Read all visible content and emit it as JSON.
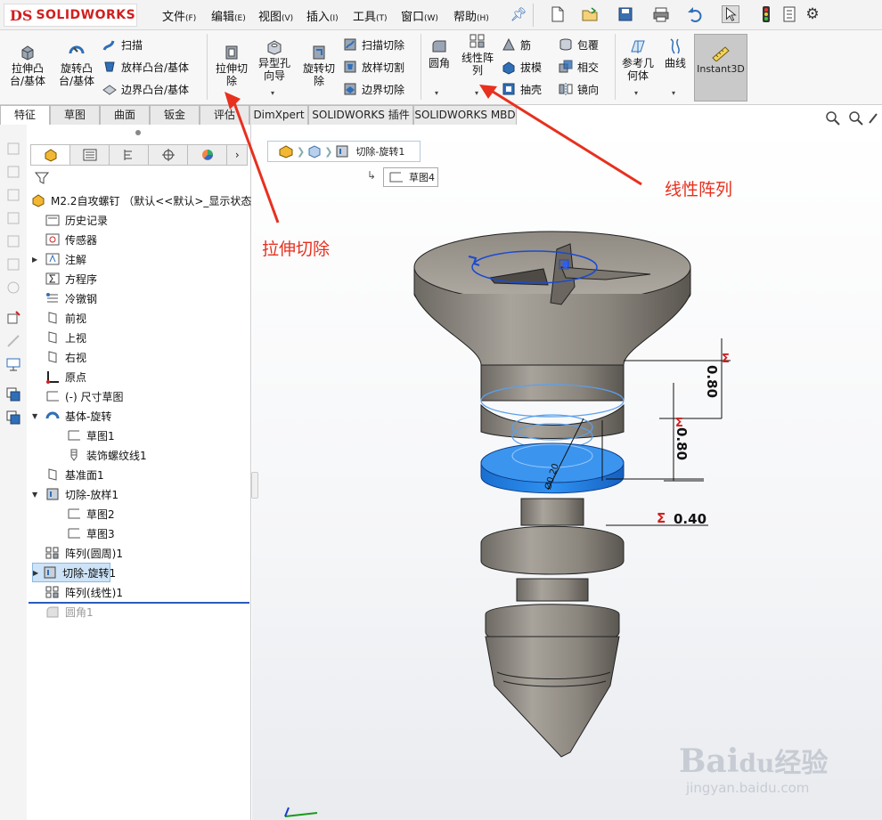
{
  "app": {
    "logo_prefix": "DS",
    "logo_text": "SOLIDWORKS"
  },
  "menu": [
    {
      "label": "文件",
      "key": "(F)"
    },
    {
      "label": "编辑",
      "key": "(E)"
    },
    {
      "label": "视图",
      "key": "(V)"
    },
    {
      "label": "插入",
      "key": "(I)"
    },
    {
      "label": "工具",
      "key": "(T)"
    },
    {
      "label": "窗口",
      "key": "(W)"
    },
    {
      "label": "帮助",
      "key": "(H)"
    }
  ],
  "ribbon": {
    "extrude_boss_l1": "拉伸凸",
    "extrude_boss_l2": "台/基体",
    "revolve_boss_l1": "旋转凸",
    "revolve_boss_l2": "台/基体",
    "sweep": "扫描",
    "loft_boss": "放样凸台/基体",
    "boundary_boss": "边界凸台/基体",
    "extrude_cut_l1": "拉伸切",
    "extrude_cut_l2": "除",
    "hole_wizard_l1": "异型孔",
    "hole_wizard_l2": "向导",
    "revolve_cut_l1": "旋转切",
    "revolve_cut_l2": "除",
    "swept_cut": "扫描切除",
    "lofted_cut": "放样切割",
    "boundary_cut": "边界切除",
    "fillet": "圆角",
    "linear_pattern_l1": "线性阵",
    "linear_pattern_l2": "列",
    "rib": "筋",
    "draft": "拔模",
    "shell": "抽壳",
    "wrap": "包覆",
    "intersect": "相交",
    "mirror": "镜向",
    "ref_geom_l1": "参考几",
    "ref_geom_l2": "何体",
    "curves": "曲线",
    "instant3d": "Instant3D"
  },
  "tabs": [
    "特征",
    "草图",
    "曲面",
    "钣金",
    "评估",
    "DimXpert",
    "SOLIDWORKS 插件",
    "SOLIDWORKS MBD"
  ],
  "tree": {
    "root": "M2.2自攻螺钉 （默认<<默认>_显示状态",
    "items": [
      {
        "label": "历史记录"
      },
      {
        "label": "传感器"
      },
      {
        "label": "注解"
      },
      {
        "label": "方程序"
      },
      {
        "label": "冷镦钢"
      },
      {
        "label": "前视"
      },
      {
        "label": "上视"
      },
      {
        "label": "右视"
      },
      {
        "label": "原点"
      },
      {
        "label": "(-) 尺寸草图"
      },
      {
        "label": "基体-旋转"
      },
      {
        "label": "草图1"
      },
      {
        "label": "装饰螺纹线1"
      },
      {
        "label": "基准面1"
      },
      {
        "label": "切除-放样1"
      },
      {
        "label": "草图2"
      },
      {
        "label": "草图3"
      },
      {
        "label": "阵列(圆周)1"
      },
      {
        "label": "切除-旋转1"
      },
      {
        "label": "阵列(线性)1"
      },
      {
        "label": "圆角1"
      }
    ]
  },
  "viewport": {
    "breadcrumb": "切除-旋转1",
    "sketch_chip": "草图4",
    "dims": [
      "0.80",
      "0.80",
      "0.40"
    ],
    "diam_label": "Ø0.20"
  },
  "annotations": {
    "extrude_cut": "拉伸切除",
    "linear_pattern": "线性阵列"
  },
  "watermark": {
    "brand": "Bai",
    "brand2": "du",
    "brand3": "经验",
    "url": "jingyan.baidu.com"
  },
  "colors": {
    "accent": "#e8301e",
    "selection_blue": "#2e86e6",
    "logo_red": "#d02020"
  }
}
